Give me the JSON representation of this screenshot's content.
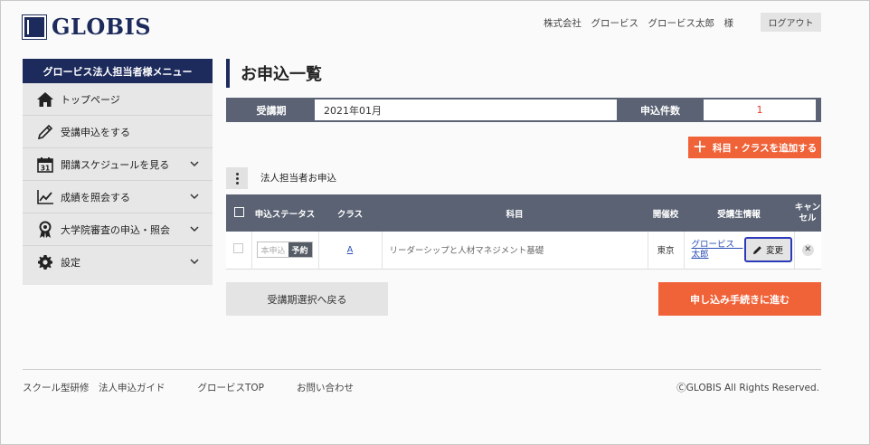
{
  "header": {
    "logo_text": "GLOBIS",
    "logo_mark_text": "GLOBIS",
    "user_label": "株式会社　グロービス　グロービス太郎　様",
    "logout_label": "ログアウト"
  },
  "sidebar": {
    "title": "グロービス法人担当者様メニュー",
    "items": [
      {
        "label": "トップページ",
        "icon": "home-icon"
      },
      {
        "label": "受講申込をする",
        "icon": "pencil-icon"
      },
      {
        "label": "開講スケジュールを見る",
        "icon": "calendar-icon",
        "calendar_day": "31"
      },
      {
        "label": "成績を照会する",
        "icon": "chart-icon"
      },
      {
        "label": "大学院審査の申込・照会",
        "icon": "award-icon"
      },
      {
        "label": "設定",
        "icon": "gear-icon"
      }
    ]
  },
  "main": {
    "page_title": "お申込一覧",
    "info": {
      "period_label": "受講期",
      "period_value": "2021年01月",
      "count_label": "申込件数",
      "count_value": "1"
    },
    "add_button": "科目・クラスを追加する",
    "section_label": "法人担当者お申込",
    "table": {
      "headers": {
        "status": "申込ステータス",
        "class": "クラス",
        "subject": "科目",
        "venue": "開催校",
        "student": "受講生情報",
        "cancel": "キャンセル"
      },
      "row": {
        "status_off": "本申込",
        "status_on": "予約",
        "class": "A",
        "subject": "リーダーシップと人材マネジメント基礎",
        "venue": "東京",
        "student": "グロービス　太郎",
        "edit_label": "変更",
        "cancel_symbol": "✕"
      }
    },
    "back_button": "受講期選択へ戻る",
    "proceed_button": "申し込み手続きに進む"
  },
  "footer": {
    "links": [
      "スクール型研修　法人申込ガイド",
      "グロービスTOP",
      "お問い合わせ"
    ],
    "copyright": "ⒸGLOBIS All Rights Reserved."
  },
  "colors": {
    "brand_navy": "#1d2b5c",
    "accent_orange": "#f06238",
    "table_header": "#5a6273",
    "count_red": "#e23b2a",
    "focus_blue": "#2c3ab8"
  }
}
